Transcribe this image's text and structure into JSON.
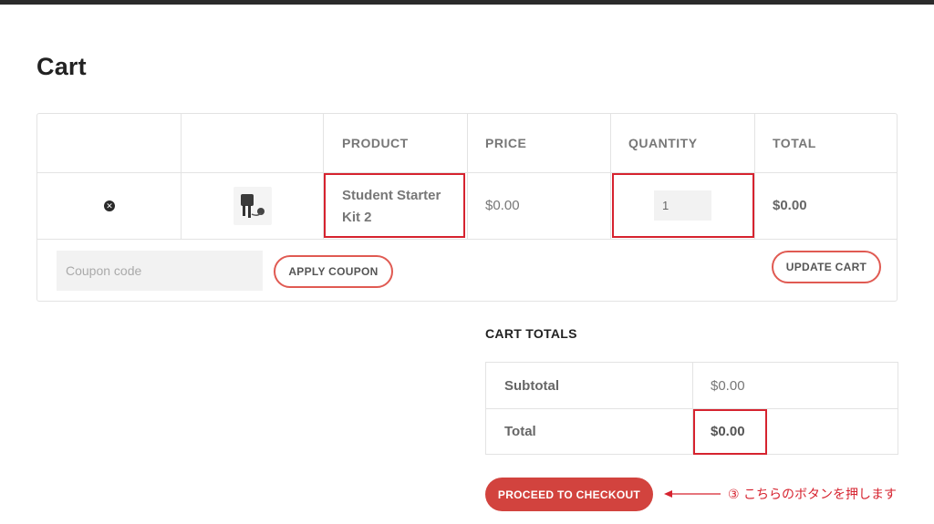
{
  "page": {
    "title": "Cart"
  },
  "cart_table": {
    "headers": [
      "PRODUCT",
      "PRICE",
      "QUANTITY",
      "TOTAL"
    ],
    "item": {
      "product_line1": "Student Starter",
      "product_line2": "Kit 2",
      "price": "$0.00",
      "quantity": "1",
      "total": "$0.00"
    },
    "coupon_placeholder": "Coupon code",
    "apply_coupon_label": "APPLY COUPON",
    "update_cart_label": "UPDATE CART"
  },
  "cart_totals": {
    "title": "CART TOTALS",
    "subtotal_label": "Subtotal",
    "subtotal_value": "$0.00",
    "total_label": "Total",
    "total_value": "$0.00"
  },
  "checkout": {
    "button_label": "PROCEED TO CHECKOUT",
    "annotation": "③ こちらのボタンを押します"
  },
  "colors": {
    "accent": "#d2433e",
    "highlight_box": "#d6232f",
    "topbar": "#2b2b2b"
  }
}
